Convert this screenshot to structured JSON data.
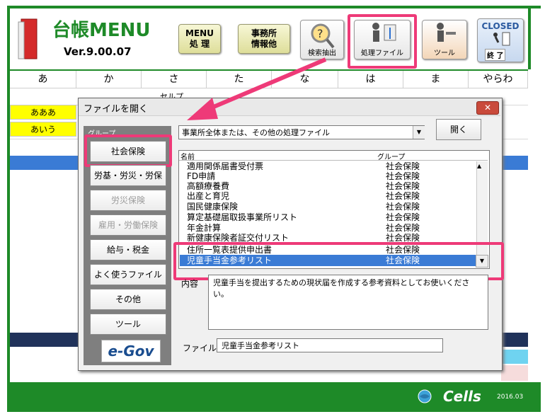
{
  "app": {
    "title": "台帳MENU",
    "version": "Ver.9.00.07"
  },
  "toolbar": {
    "menu_btn": "MENU\n処 理",
    "office_btn": "事務所\n情報他",
    "search_btn": "検索抽出",
    "file_btn": "処理ファイル",
    "tool_btn": "ツール",
    "closed_btn_top": "CLOSED",
    "closed_btn_bottom": "終 了"
  },
  "columns": [
    "あ",
    "か",
    "さ",
    "た",
    "な",
    "は",
    "ま",
    "やらわ"
  ],
  "sheet": {
    "cell1": "あああ",
    "cell2": "あいう",
    "partial_text": "セルプ"
  },
  "dialog": {
    "title": "ファイルを開く",
    "close": "✕",
    "group_label": "グループ",
    "group_buttons": [
      {
        "label": "社会保険",
        "disabled": false
      },
      {
        "label": "労基・労災・労保",
        "disabled": false
      },
      {
        "label": "労災保険",
        "disabled": true
      },
      {
        "label": "雇用・労働保険",
        "disabled": true
      },
      {
        "label": "給与・税金",
        "disabled": false
      },
      {
        "label": "よく使うファイル",
        "disabled": false
      },
      {
        "label": "その他",
        "disabled": false
      },
      {
        "label": "ツール",
        "disabled": false
      }
    ],
    "egov_label": "e-Gov",
    "combo_value": "事業所全体または、その他の処理ファイル",
    "open_button": "開く",
    "list_header_name": "名前",
    "list_header_group": "グループ",
    "list_rows": [
      {
        "name": "適用関係届書受付票",
        "group": "社会保険"
      },
      {
        "name": "FD申請",
        "group": "社会保険"
      },
      {
        "name": "高額療養費",
        "group": "社会保険"
      },
      {
        "name": "出産と育児",
        "group": "社会保険"
      },
      {
        "name": "国民健康保険",
        "group": "社会保険"
      },
      {
        "name": "算定基礎届取扱事業所リスト",
        "group": "社会保険"
      },
      {
        "name": "年金計算",
        "group": "社会保険"
      },
      {
        "name": "新健康保険者証交付リスト",
        "group": "社会保険"
      },
      {
        "name": "住所一覧表提供申出書",
        "group": "社会保険"
      },
      {
        "name": "児童手当金参考リスト",
        "group": "社会保険"
      }
    ],
    "content_label": "内容",
    "content_text": "児童手当を提出するための現状届を作成する参考資料としてお使いください。",
    "filename_label": "ファイル名",
    "filename_value": "児童手当金参考リスト"
  },
  "footer": {
    "brand": "Cells",
    "date": "2016.03"
  },
  "colors": {
    "green": "#1e8a28",
    "highlight": "#ee3a78",
    "selection": "#3a7bd5"
  }
}
